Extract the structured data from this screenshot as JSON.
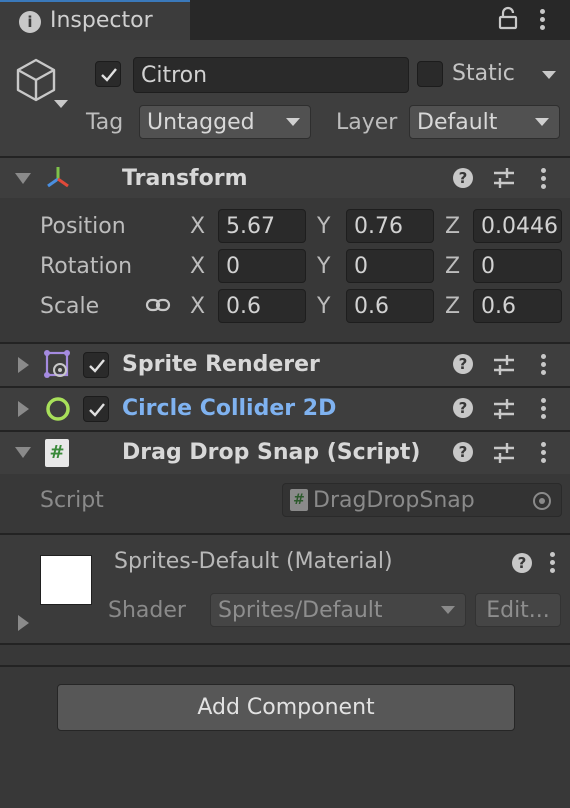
{
  "tab": {
    "title": "Inspector"
  },
  "object": {
    "name": "Citron",
    "active": true,
    "static_label": "Static",
    "static_checked": false
  },
  "tag": {
    "label": "Tag",
    "value": "Untagged"
  },
  "layer": {
    "label": "Layer",
    "value": "Default"
  },
  "transform": {
    "title": "Transform",
    "position": {
      "label": "Position",
      "x": "5.67",
      "y": "0.76",
      "z": "0.0446"
    },
    "rotation": {
      "label": "Rotation",
      "x": "0",
      "y": "0",
      "z": "0"
    },
    "scale": {
      "label": "Scale",
      "x": "0.6",
      "y": "0.6",
      "z": "0.6"
    },
    "axes": {
      "x": "X",
      "y": "Y",
      "z": "Z"
    }
  },
  "components": {
    "sprite_renderer": {
      "title": "Sprite Renderer",
      "enabled": true
    },
    "circle_collider": {
      "title": "Circle Collider 2D",
      "enabled": true
    },
    "script": {
      "title": "Drag Drop Snap (Script)",
      "field_label": "Script",
      "field_value": "DragDropSnap"
    }
  },
  "material": {
    "title": "Sprites-Default (Material)",
    "shader_label": "Shader",
    "shader_value": "Sprites/Default",
    "edit_label": "Edit..."
  },
  "add_component": {
    "label": "Add Component"
  },
  "colors": {
    "background": "#383838",
    "header": "#3e3e3e",
    "field": "#2a2a2a",
    "accent_blue": "#7fb2f0"
  },
  "icons": [
    "info-icon",
    "lock-icon",
    "kebab-menu-icon",
    "gameobject-cube-icon",
    "transform-axes-icon",
    "sprite-renderer-icon",
    "circle-collider-icon",
    "script-hash-icon",
    "help-icon",
    "preset-sliders-icon",
    "link-icon",
    "object-picker-icon"
  ]
}
